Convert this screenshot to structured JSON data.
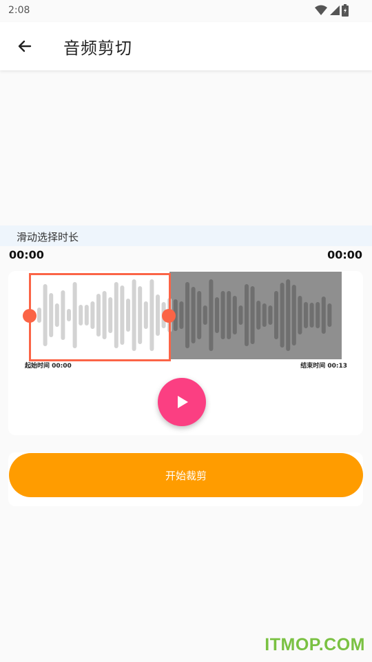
{
  "status_bar": {
    "time": "2:08"
  },
  "header": {
    "title": "音频剪切"
  },
  "section": {
    "label": "滑动选择时长"
  },
  "timeline": {
    "left_time": "00:00",
    "right_time": "00:00",
    "start_label": "起始时间 00:00",
    "end_label": "结束时间 00:13"
  },
  "actions": {
    "cut_label": "开始裁剪"
  },
  "watermark": "ITMOP.COM",
  "colors": {
    "accent_selection": "#fb6446",
    "play_button": "#fb3f82",
    "cut_button": "#ff9c00",
    "waveform_light": "#d3d3d3",
    "waveform_dark": "#6f6f6f"
  },
  "icons": {
    "back": "arrow-left-icon",
    "play": "play-icon",
    "wifi": "wifi-icon",
    "signal": "signal-icon",
    "battery": "battery-icon"
  }
}
